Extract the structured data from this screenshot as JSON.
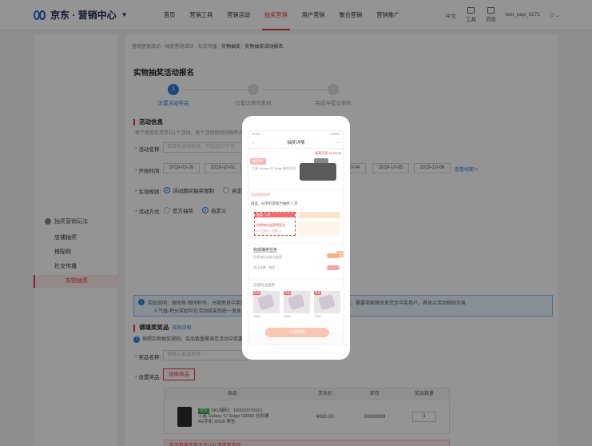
{
  "header": {
    "logo_text": "京东 · 营销中心",
    "logo_caret": "▼",
    "nav": [
      "首页",
      "营销工具",
      "营销活动",
      "抽奖营销",
      "用户营销",
      "聚合营销",
      "营销推广"
    ],
    "active_nav_index": 3,
    "lang": "中文",
    "tool1": "工具",
    "tool2": "消息",
    "user": "test_pop_0171"
  },
  "sidebar": {
    "title": "抽奖营销玩法",
    "items": [
      "店铺抽奖",
      "搭配购",
      "社交传播",
      "实物抽奖"
    ],
    "active_index": 3
  },
  "breadcrumb": {
    "text": "营销营销活动 · 抽奖营销活动 · 社交传播 · ",
    "current": "实物抽奖 · 实物抽奖活动报名"
  },
  "page": {
    "title": "实物抽奖活动报名",
    "steps": [
      {
        "num": "1",
        "label": "设置活动奖品"
      },
      {
        "num": "2",
        "label": "设置详情页素材"
      },
      {
        "num": "3",
        "label": "完成并提交审核"
      }
    ]
  },
  "activity": {
    "section_title": "活动信息",
    "note": "每个商品仅可参与1个活动，每个活动按时间顺序进行展示",
    "name_label": "活动名称:",
    "name_placeholder": "请填写活动名称，不超过20个字",
    "time_label": "开始时间:",
    "dates": [
      "2019-03-26",
      "2019-10-01",
      "2019-10-04",
      "2019-10-05",
      "2019-10-06"
    ],
    "date_link": "查看档期 >",
    "mode_label": "生效规则:",
    "mode_options": [
      "活动期间抽奖限制",
      "自定义规则"
    ],
    "mode_selected": 0,
    "type_label": "活动方式:",
    "type_options": [
      "官方抽奖",
      "自定义"
    ],
    "type_selected": 1
  },
  "info": {
    "line1": "奖励说明：限时抢·限时秒杀，分期免息中奖后按订单实付金额计算折扣，奖品按照活动规则发放，需要商家按时发货至中奖用户，具体以活动规则为准",
    "line2": "人气值·积分奖励可在活动结束后统一发放"
  },
  "prize": {
    "section_title": "请填奖奖品",
    "section_link": "规则说明",
    "note": "按照实物抽奖规则，奖品数量需满足活动中奖要求，奖品需为店铺在售商品",
    "name_label": "奖品名称:",
    "name_placeholder": "请输入奖品名称",
    "goods_label": "设置奖品:",
    "goods_button": "选择商品",
    "table_headers": [
      "商品",
      "京东价",
      "库存",
      "奖品数量"
    ],
    "rows": [
      {
        "tag": "京东",
        "sku": "SKU编码：100010375021",
        "title": "三星 Galaxy S7 Edge G9350 全网通 4G手机 32GB 黑色",
        "price": "¥830.00",
        "stock": "99999999",
        "qty": "1"
      }
    ],
    "warning": "奖品数量不能大于100 请重新选择"
  },
  "modal": {
    "status_left": "9:41",
    "status_right": "100%",
    "title": "抽奖详情",
    "back": "‹",
    "more": "···",
    "tag": "抽奖中",
    "top_red": "距离开奖 12:00:00",
    "caption": "三星 Galaxy S7 Edge 抽奖活动",
    "rule_pink": "活动规则说明",
    "rule_text": "商品 · 分享好友助力抽奖 1 次",
    "card_header": "抽奖 · 1次",
    "card_line1": "你将有机会获得奖品",
    "card_line2": "0人已参与 · 还差1人",
    "tasks_title": "完成抽奖任务",
    "tasks_sub1": "分享给好友助力抽奖",
    "tasks_sub2": "关注店铺 · 抽奖",
    "goods_title": "店铺商品推荐",
    "goods": [
      {
        "badge": "热卖",
        "bar": "¥999"
      },
      {
        "badge": "热卖",
        "bar": "¥599"
      },
      {
        "badge": "热卖",
        "bar": "¥399"
      }
    ],
    "cta": "立即抽奖"
  },
  "colors": {
    "accent_red": "#e4393c",
    "accent_blue": "#2f7fe0"
  }
}
